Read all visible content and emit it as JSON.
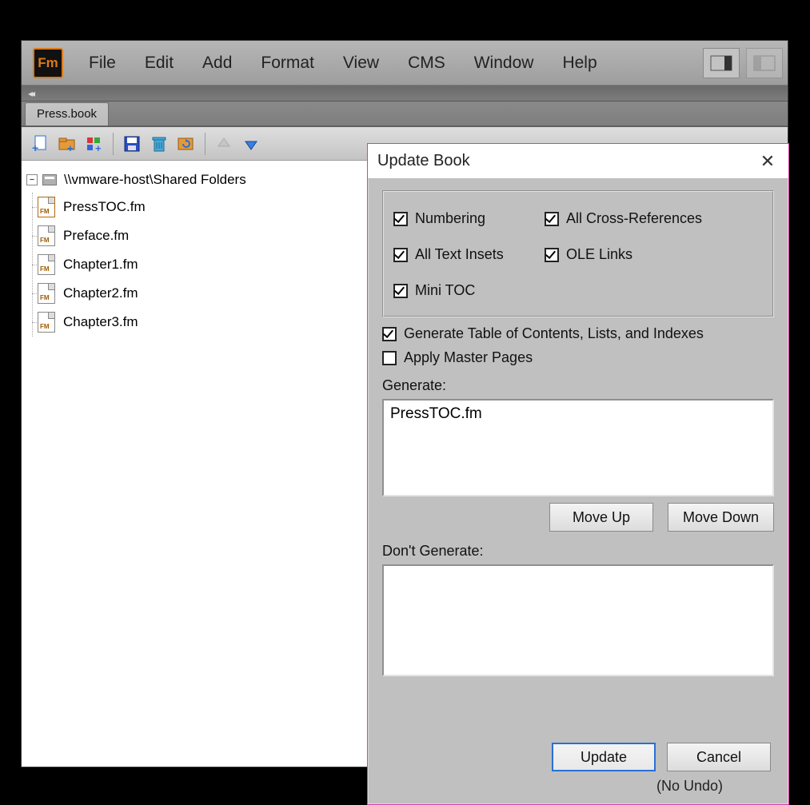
{
  "app": {
    "logo_text": "Fm"
  },
  "menu": {
    "items": [
      "File",
      "Edit",
      "Add",
      "Format",
      "View",
      "CMS",
      "Window",
      "Help"
    ]
  },
  "tab": {
    "label": "Press.book"
  },
  "tree": {
    "root": "\\\\vmware-host\\Shared Folders",
    "files": [
      "PressTOC.fm",
      "Preface.fm",
      "Chapter1.fm",
      "Chapter2.fm",
      "Chapter3.fm"
    ]
  },
  "dialog": {
    "title": "Update Book",
    "checkboxes": {
      "numbering": "Numbering",
      "cross_refs": "All Cross-References",
      "text_insets": "All Text Insets",
      "ole_links": "OLE Links",
      "mini_toc": "Mini TOC",
      "generate_toc": "Generate Table of Contents, Lists, and Indexes",
      "apply_master": "Apply Master Pages"
    },
    "generate_label": "Generate:",
    "generate_items": [
      "PressTOC.fm"
    ],
    "dont_generate_label": "Don't Generate:",
    "move_up": "Move Up",
    "move_down": "Move Down",
    "update": "Update",
    "cancel": "Cancel",
    "no_undo": "(No Undo)"
  }
}
